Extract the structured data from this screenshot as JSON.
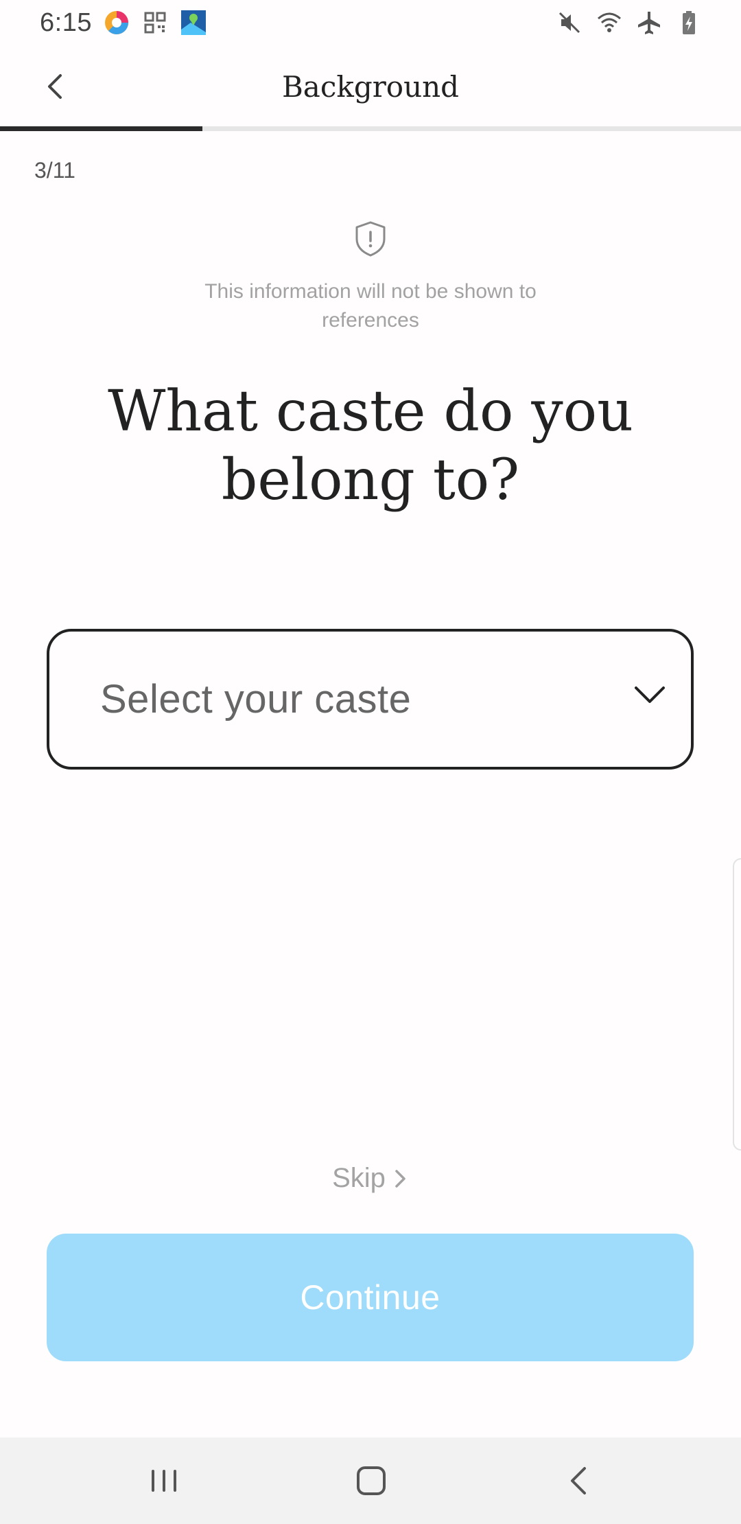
{
  "status_bar": {
    "time": "6:15",
    "left_icons": [
      "chrome-like-app-icon",
      "qr-code-icon",
      "maps-app-icon"
    ],
    "right_icons": [
      "mute-icon",
      "wifi-icon",
      "airplane-mode-icon",
      "battery-charging-icon"
    ]
  },
  "header": {
    "title": "Background",
    "back_icon": "chevron-left-icon"
  },
  "progress": {
    "fraction": 0.2727,
    "step": "3/11"
  },
  "privacy": {
    "icon": "shield-alert-icon",
    "note": "This information will not be shown to references"
  },
  "question": "What caste do you belong to?",
  "caste_select": {
    "placeholder": "Select your caste",
    "icon": "chevron-down-icon"
  },
  "skip": {
    "label": "Skip",
    "icon": "chevron-right-icon"
  },
  "continue_button": {
    "label": "Continue",
    "color": "#9fdcfb"
  },
  "nav_bar": {
    "recents_icon": "recents-icon",
    "home_icon": "home-icon",
    "back_icon": "back-icon"
  }
}
